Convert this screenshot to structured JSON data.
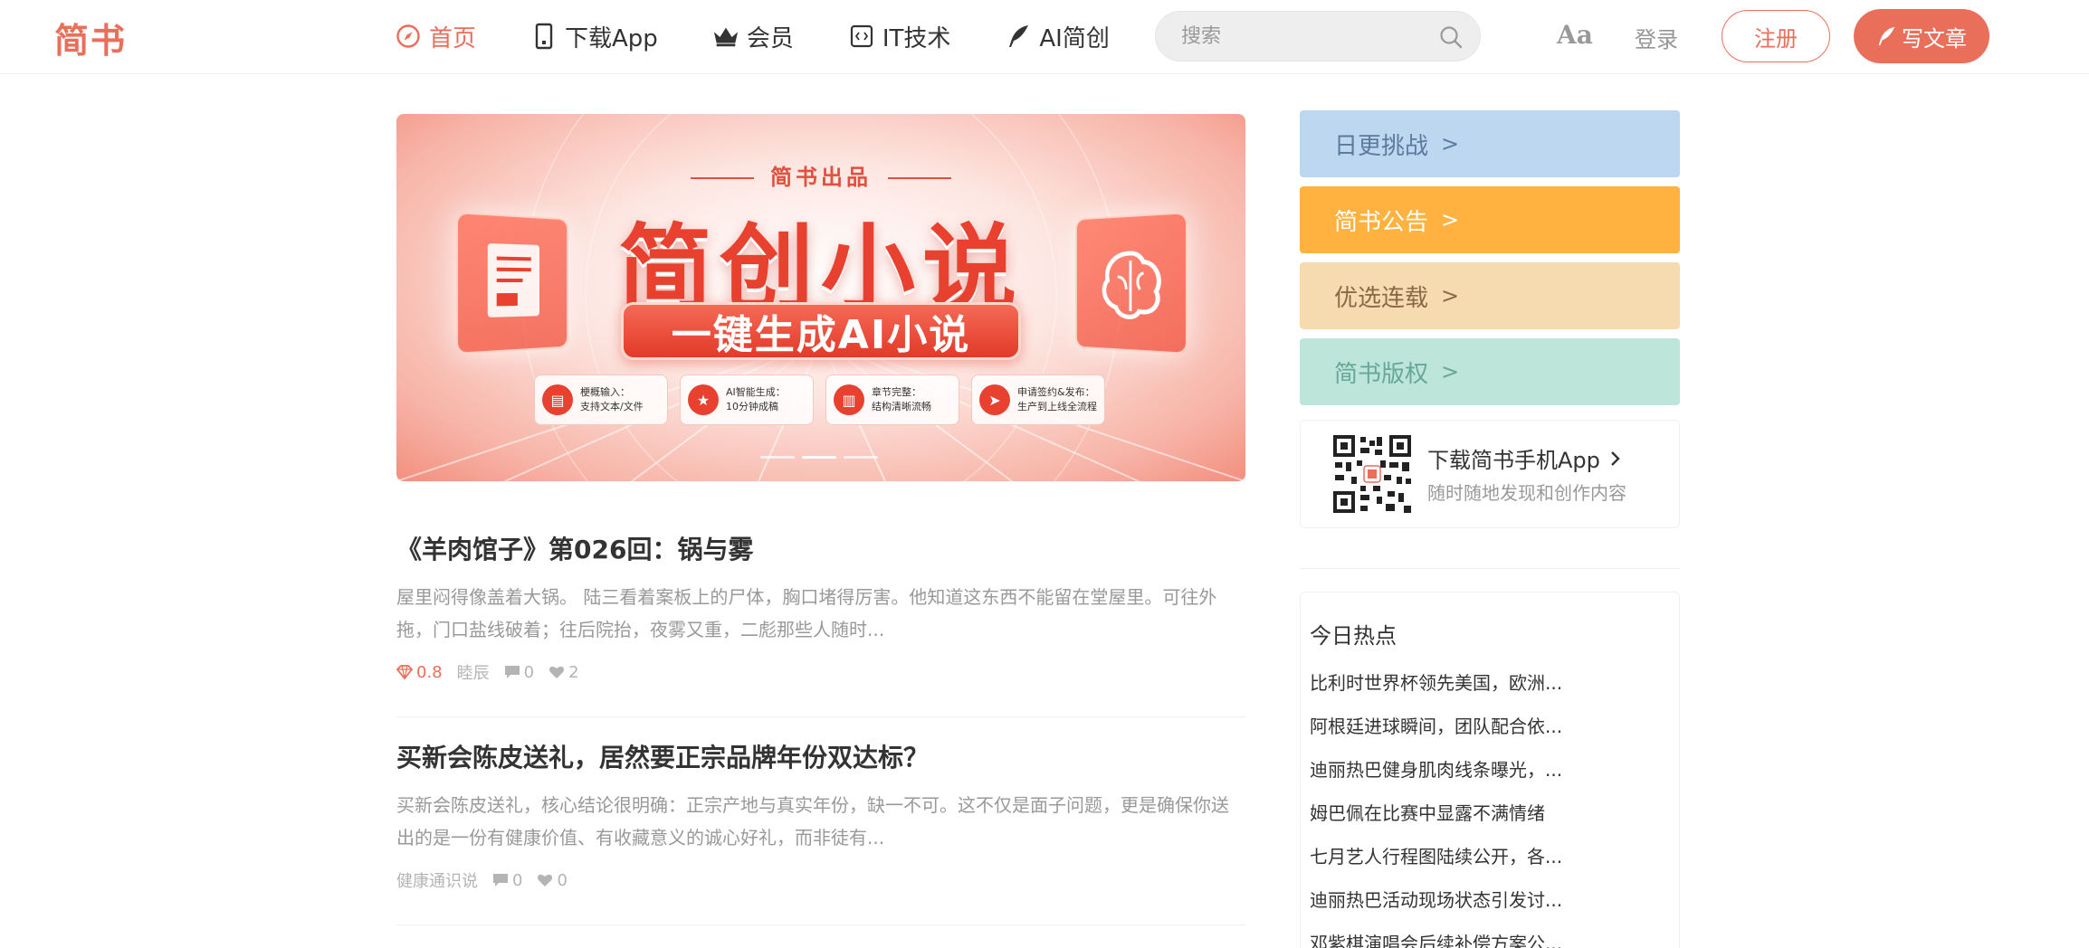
{
  "header": {
    "logo": "简书",
    "nav": [
      {
        "label": "首页",
        "icon": "compass-icon",
        "active": true
      },
      {
        "label": "下载App",
        "icon": "phone-icon",
        "active": false
      },
      {
        "label": "会员",
        "icon": "crown-icon",
        "active": false
      },
      {
        "label": "IT技术",
        "icon": "code-icon",
        "active": false
      },
      {
        "label": "AI简创",
        "icon": "feather-icon",
        "active": false
      }
    ],
    "search_placeholder": "搜索",
    "font_toggle": "Aa",
    "login": "登录",
    "signup": "注册",
    "write": "写文章"
  },
  "banner": {
    "brand": "简书出品",
    "headline": "简创小说",
    "tagline": "一键生成AI小说",
    "features": [
      {
        "line1": "梗概输入：",
        "line2": "支持文本/文件",
        "icon": "document-icon"
      },
      {
        "line1": "AI智能生成：",
        "line2": "10分钟成稿",
        "icon": "star-icon"
      },
      {
        "line1": "章节完整：",
        "line2": "结构清晰流畅",
        "icon": "book-icon"
      },
      {
        "line1": "申请签约&发布：",
        "line2": "生产到上线全流程",
        "icon": "send-icon"
      }
    ]
  },
  "articles": [
    {
      "title": "《羊肉馆子》第026回：锅与雾",
      "abstract": "屋里闷得像盖着大锅。 陆三看着案板上的尸体，胸口堵得厉害。他知道这东西不能留在堂屋里。可往外拖，门口盐线破着；往后院抬，夜雾又重，二彪那些人随时...",
      "jewel": "0.8",
      "author": "睦辰",
      "comments": "0",
      "likes": "2"
    },
    {
      "title": "买新会陈皮送礼，居然要正宗品牌年份双达标？",
      "abstract": "买新会陈皮送礼，核心结论很明确：正宗产地与真实年份，缺一不可。这不仅是面子问题，更是确保你送出的是一份有健康价值、有收藏意义的诚心好礼，而非徒有...",
      "author": "健康通识说",
      "comments": "0",
      "likes": "0"
    }
  ],
  "sidebar": {
    "boards": [
      {
        "label": "日更挑战",
        "color": "#bdd7f0",
        "text_color": "#5b7a9e"
      },
      {
        "label": "简书公告",
        "color": "#ffb23f",
        "text_color": "#ffffff"
      },
      {
        "label": "优选连载",
        "color": "#f6dbb1",
        "text_color": "#8a6a44"
      },
      {
        "label": "简书版权",
        "color": "#bde5d9",
        "text_color": "#66a898"
      }
    ],
    "download": {
      "title": "下载简书手机App",
      "subtitle": "随时随地发现和创作内容"
    },
    "hot": {
      "title": "今日热点",
      "items": [
        "比利时世界杯领先美国，欧洲...",
        "阿根廷进球瞬间，团队配合依...",
        "迪丽热巴健身肌肉线条曝光，...",
        "姆巴佩在比赛中显露不满情绪",
        "七月艺人行程图陆续公开，各...",
        "迪丽热巴活动现场状态引发讨...",
        "邓紫棋演唱会后续补偿方案公..."
      ]
    }
  },
  "colors": {
    "brand": "#ea6f5a",
    "text": "#333333",
    "muted": "#999999"
  }
}
